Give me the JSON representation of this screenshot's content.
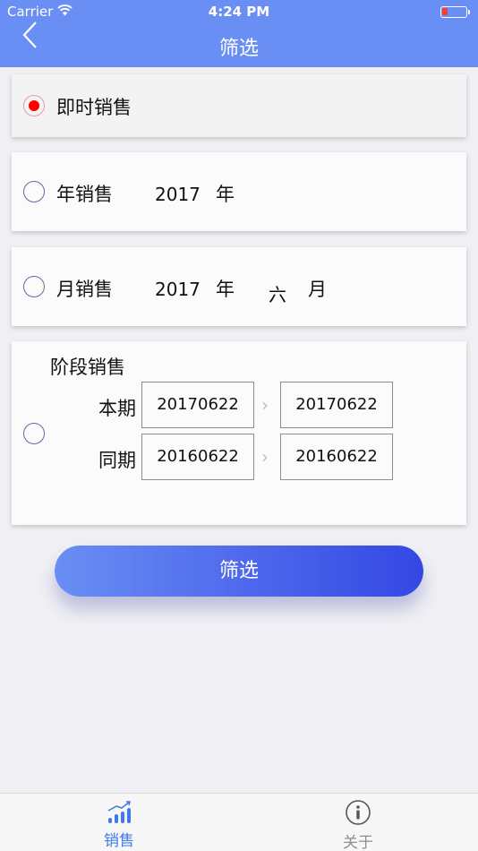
{
  "status_bar": {
    "carrier": "Carrier",
    "time": "4:24 PM"
  },
  "nav": {
    "title": "筛选",
    "back_icon": "chevron-left-icon"
  },
  "options": {
    "instant": {
      "label": "即时销售",
      "selected": true
    },
    "yearly": {
      "label": "年销售",
      "year": "2017",
      "year_unit": "年",
      "selected": false
    },
    "monthly": {
      "label": "月销售",
      "year": "2017",
      "year_unit": "年",
      "month": "六",
      "month_unit": "月",
      "selected": false
    },
    "period": {
      "label": "阶段销售",
      "selected": false,
      "current": {
        "label": "本期",
        "start": "20170622",
        "end": "20170622"
      },
      "previous": {
        "label": "同期",
        "start": "20160622",
        "end": "20160622"
      }
    }
  },
  "filter_button": {
    "label": "筛选"
  },
  "colors": {
    "nav_bg": "#6a8ff4",
    "accent": "#3d7be8",
    "radio_checked": "#ff0000",
    "button_start": "#6a8ef4",
    "button_end": "#3447e4"
  },
  "tabbar": {
    "tabs": [
      {
        "label": "销售",
        "icon": "bar-chart-icon",
        "active": true
      },
      {
        "label": "关于",
        "icon": "info-icon",
        "active": false
      }
    ]
  }
}
